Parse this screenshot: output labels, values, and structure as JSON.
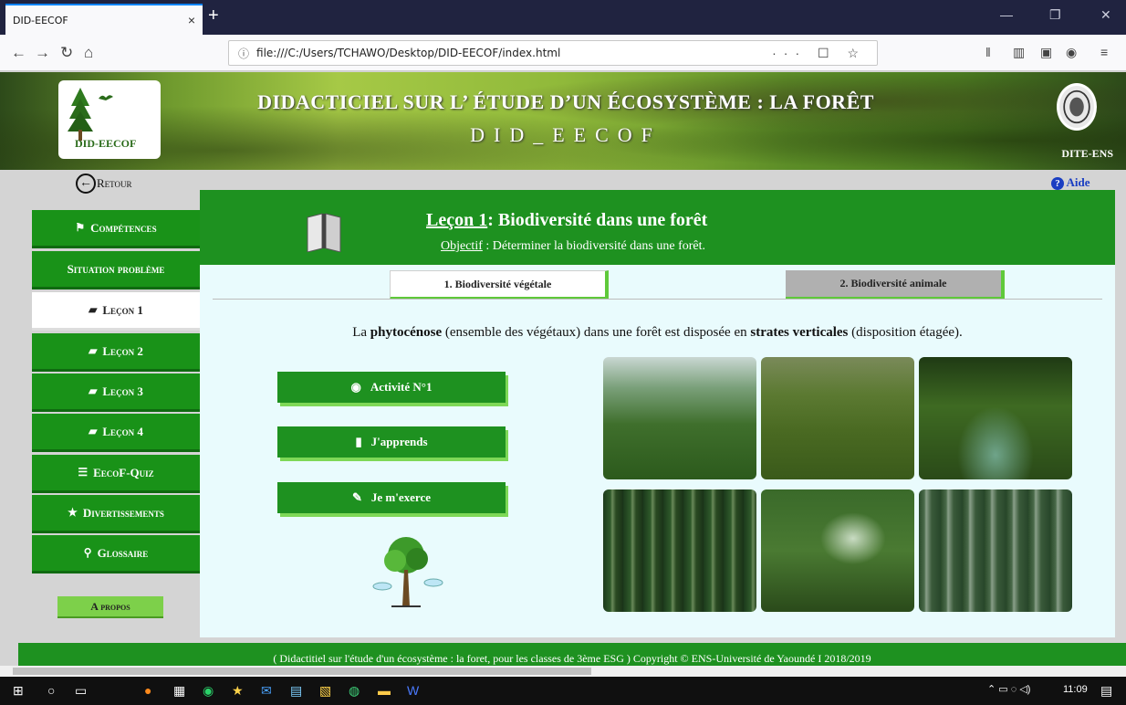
{
  "browser": {
    "tab_title": "DID-EECOF",
    "tab_close": "×",
    "new_tab": "+",
    "url_info_icon": "ⓘ",
    "url": "file:///C:/Users/TCHAWO/Desktop/DID-EECOF/index.html",
    "url_actions": "··· ☐ ☆"
  },
  "banner": {
    "logo_text": "DID-EECOF",
    "title": "DIDACTICIEL SUR L’ ÉTUDE D’UN ÉCOSYSTÈME : LA FORÊT",
    "subtitle": "DID_EECOF",
    "seal_label": "DITE-ENS"
  },
  "nav": {
    "retour": "Retour",
    "aide": "Aide"
  },
  "sidebar": {
    "items": [
      {
        "label": "Compétences",
        "icon": "flag-icon",
        "glyph": "⚑"
      },
      {
        "label": "Situation problème",
        "icon": "",
        "glyph": ""
      },
      {
        "label": "Leçon 1",
        "icon": "book-icon",
        "glyph": "▰"
      },
      {
        "label": "Leçon 2",
        "icon": "book-icon",
        "glyph": "▰"
      },
      {
        "label": "Leçon 3",
        "icon": "book-icon",
        "glyph": "▰"
      },
      {
        "label": "Leçon 4",
        "icon": "book-icon",
        "glyph": "▰"
      },
      {
        "label": "EecoF-Quiz",
        "icon": "list-icon",
        "glyph": "☰"
      },
      {
        "label": "Divertissements",
        "icon": "star-icon",
        "glyph": "★"
      },
      {
        "label": "Glossaire",
        "icon": "search-icon",
        "glyph": "⚲"
      }
    ],
    "active_index": 2,
    "apropos": "A propos"
  },
  "lesson": {
    "title_prefix": "Leçon 1",
    "title_rest": ": Biodiversité dans une forêt",
    "objective_label": "Objectif",
    "objective_text": " : Déterminer la biodiversité dans une forêt."
  },
  "tabs": [
    {
      "label": "1. Biodiversité végétale",
      "active": true
    },
    {
      "label": "2. Biodiversité animale",
      "active": false
    }
  ],
  "intro": {
    "part1": "La ",
    "bold1": "phytocénose",
    "part2": " (ensemble des végétaux) dans une forêt est disposée en ",
    "bold2": "strates verticales",
    "part3": " (disposition étagée)."
  },
  "actions": [
    {
      "label": "Activité N°1",
      "icon": "eye-icon",
      "glyph": "◉"
    },
    {
      "label": "J'apprends",
      "icon": "book-icon",
      "glyph": "▮"
    },
    {
      "label": "Je m'exerce",
      "icon": "pencil-icon",
      "glyph": "✎"
    }
  ],
  "footer": {
    "text": "( Didactitiel sur l'étude d'un écosystème : la foret, pour les classes de 3ème ESG )  Copyright © ENS-Université de Yaoundé I  2018/2019"
  },
  "taskbar": {
    "clock": "11:09"
  },
  "colors": {
    "green": "#1e9120",
    "light_green": "#7ed857",
    "panel_bg": "#e9fbfd",
    "help_blue": "#1a3ec2"
  }
}
